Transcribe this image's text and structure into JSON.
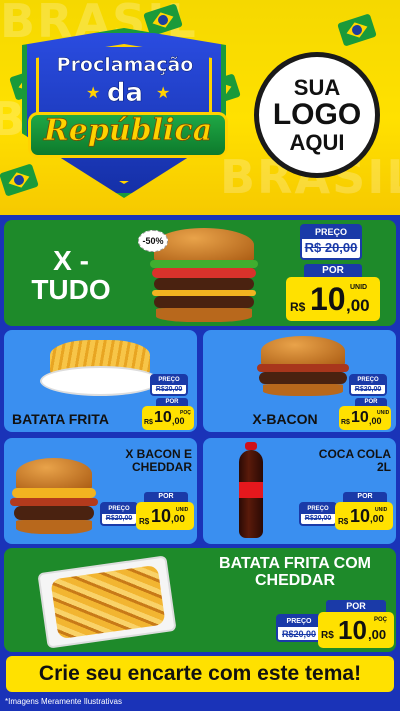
{
  "header": {
    "bg_word": "BRASIL",
    "title_line1": "Proclamação",
    "title_line2": "da",
    "title_line3": "República",
    "logo": {
      "line1": "SUA",
      "line2": "LOGO",
      "line3": "AQUI"
    }
  },
  "products": [
    {
      "name_l1": "X -",
      "name_l2": "TUDO",
      "badge": "-50%",
      "old_label": "PREÇO",
      "old_price": "R$ 20,00",
      "por": "POR",
      "currency": "R$",
      "price_int": "10",
      "price_dec": ",00",
      "unit": "UNID"
    },
    {
      "name": "BATATA FRITA",
      "old_label": "PREÇO",
      "old_price": "R$20,00",
      "por": "POR",
      "currency": "R$",
      "price_int": "10",
      "price_dec": ",00",
      "unit": "POÇ"
    },
    {
      "name": "X-BACON",
      "old_label": "PREÇO",
      "old_price": "R$20,00",
      "por": "POR",
      "currency": "R$",
      "price_int": "10",
      "price_dec": ",00",
      "unit": "UNID"
    },
    {
      "name_l1": "X BACON E",
      "name_l2": "CHEDDAR",
      "old_label": "PREÇO",
      "old_price": "R$20,00",
      "por": "POR",
      "currency": "R$",
      "price_int": "10",
      "price_dec": ",00",
      "unit": "UNID"
    },
    {
      "name_l1": "COCA COLA",
      "name_l2": "2L",
      "old_label": "PREÇO",
      "old_price": "R$20,00",
      "por": "POR",
      "currency": "R$",
      "price_int": "10",
      "price_dec": ",00",
      "unit": "UNID"
    },
    {
      "name_l1": "BATATA FRITA COM",
      "name_l2": "CHEDDAR",
      "old_label": "PREÇO",
      "old_price": "R$20,00",
      "por": "POR",
      "currency": "R$",
      "price_int": "10",
      "price_dec": ",00",
      "unit": "POÇ"
    }
  ],
  "cta": "Crie seu encarte com este tema!",
  "disclaimer": "*Imagens Meramente Ilustrativas"
}
